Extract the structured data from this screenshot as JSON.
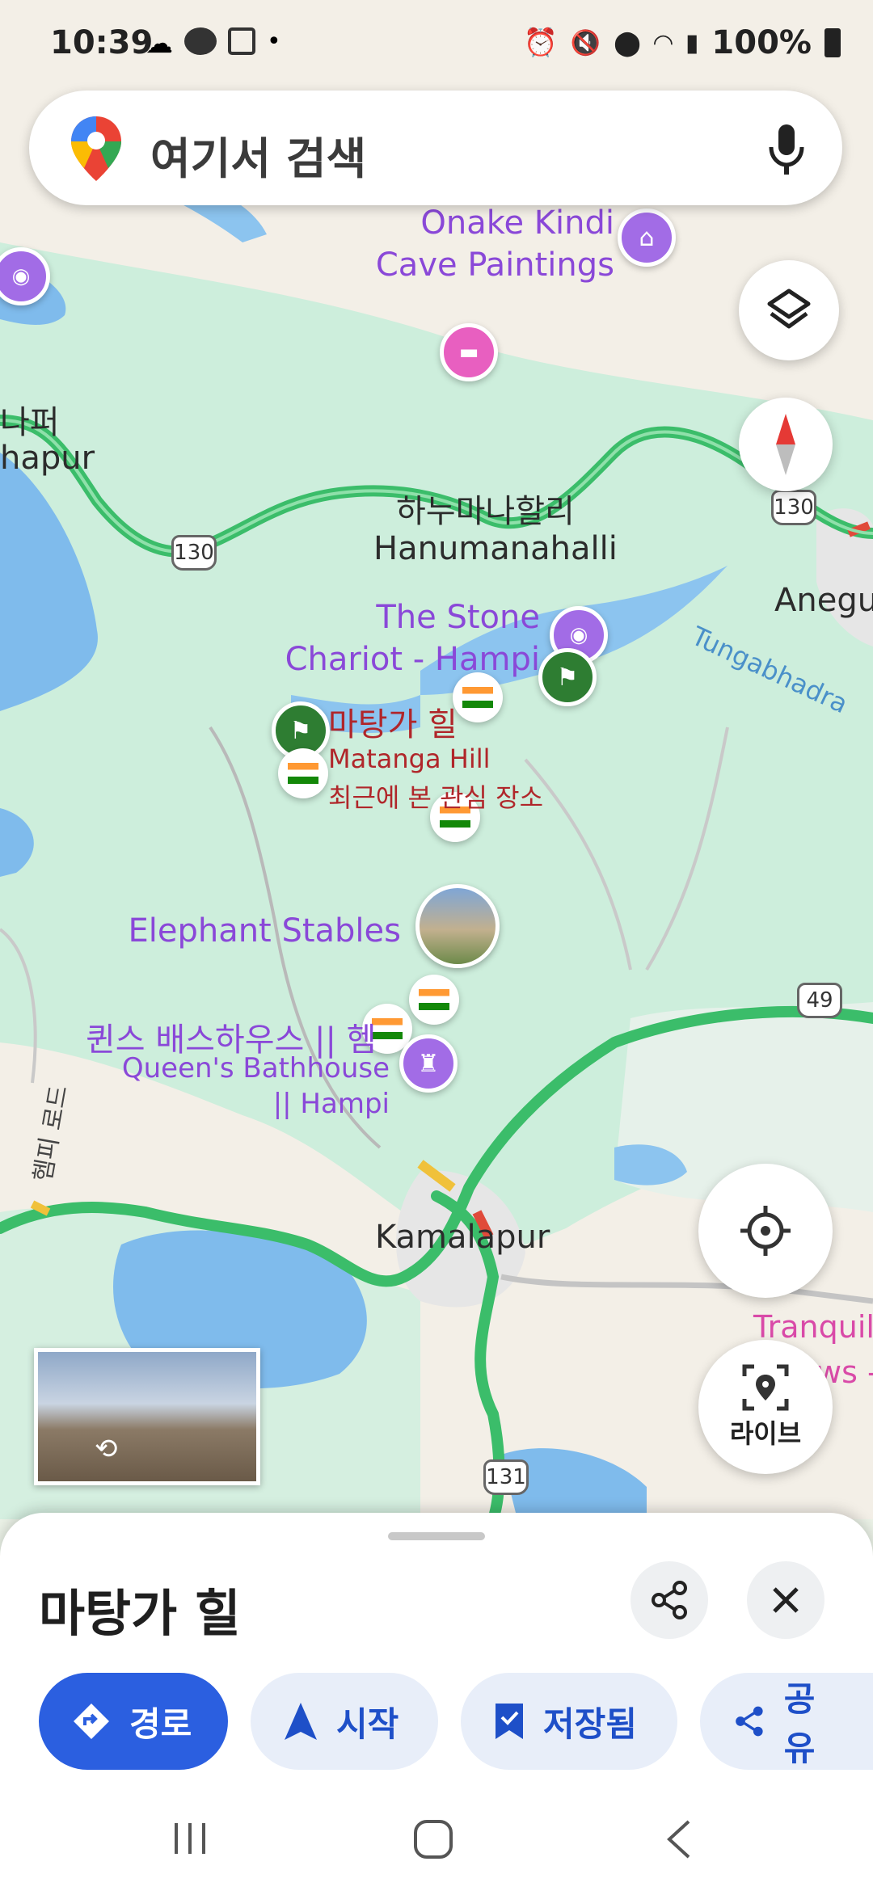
{
  "status_bar": {
    "time": "10:39",
    "battery": "100%"
  },
  "search": {
    "placeholder": "여기서 검색"
  },
  "map": {
    "labels": {
      "onake": "Onake Kindi\nCave Paintings",
      "hanu_ko": "하누마나할리",
      "hanu_en": "Hanumanahalli",
      "stone_chariot": "The Stone\nChariot - Hampi",
      "matanga_ko": "마탕가 힐",
      "matanga_en": "Matanga Hill",
      "recent": "최근에 본 관심 장소",
      "elephant": "Elephant Stables",
      "queens_ko": "퀸스 배스하우스 || 헴",
      "queens_en": "Queen's Bathhouse\n|| Hampi",
      "kamalapur": "Kamalapur",
      "anegu": "Anegu",
      "tungabhadra": "Tungabhadra",
      "left_ko": "나퍼",
      "left_en": "hapur",
      "hampi_road": "헴피 로드",
      "tranquil": "Tranquil",
      "tranquil2": "ws -"
    },
    "routes": {
      "r130a": "130",
      "r130b": "130",
      "r49": "49",
      "r131": "131"
    },
    "live_label": "라이브"
  },
  "sheet": {
    "title": "마탕가 힐",
    "actions": [
      {
        "label": "경로"
      },
      {
        "label": "시작"
      },
      {
        "label": "저장됨"
      },
      {
        "label": "공유"
      }
    ]
  },
  "colors": {
    "road_green": "#3cc26b",
    "water": "#7bb8ec",
    "park": "#cdefdb",
    "poi_purple": "#a26ce6",
    "accent_blue": "#2b5fe0"
  }
}
